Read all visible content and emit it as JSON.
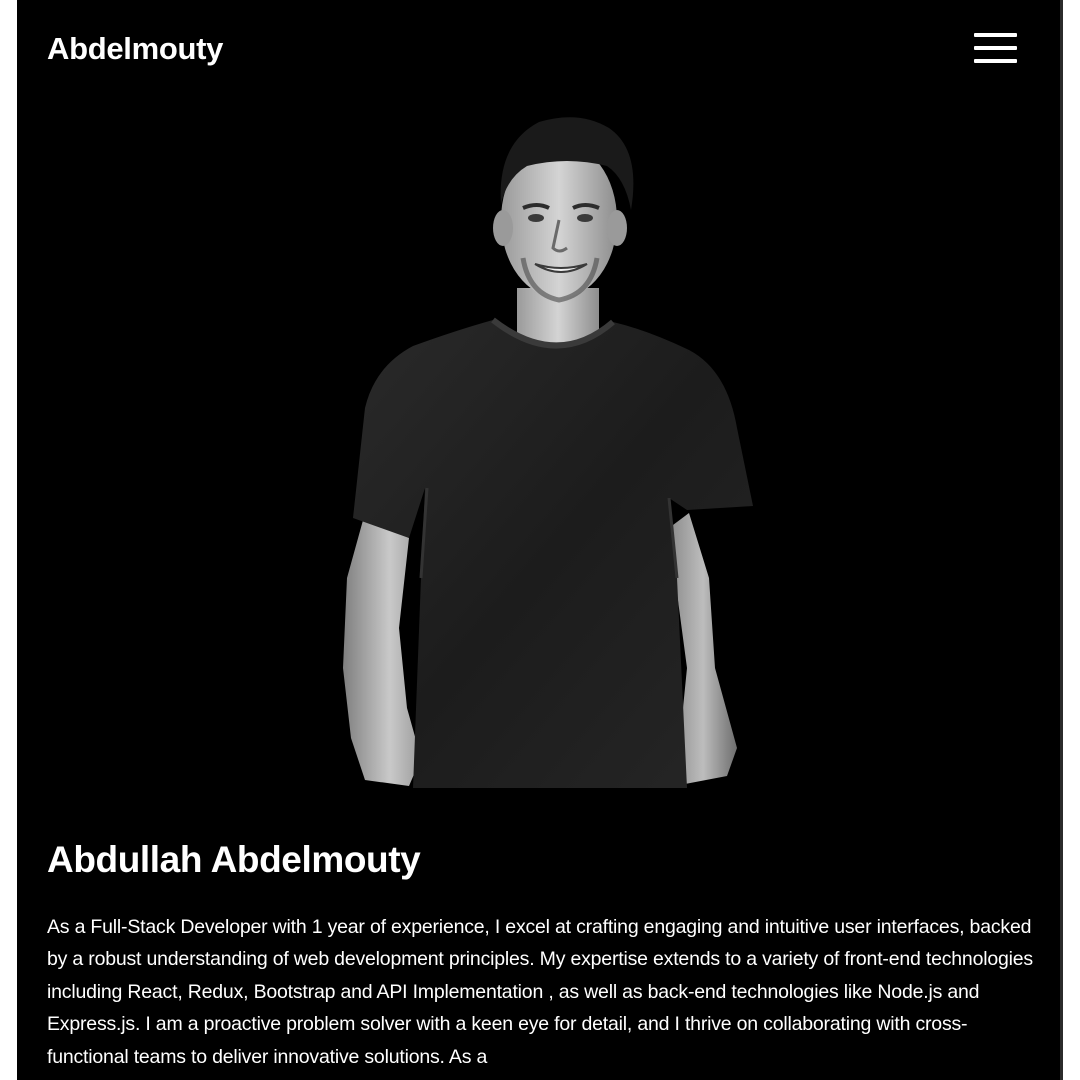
{
  "navbar": {
    "brand": "Abdelmouty",
    "menu_icon": "hamburger-menu-icon"
  },
  "hero": {
    "photo_description_icon": "portrait-photo",
    "name": "Abdullah Abdelmouty",
    "bio": "As a Full-Stack Developer with 1 year of experience, I excel at crafting engaging and intuitive user interfaces, backed by a robust understanding of web development principles. My expertise extends to a variety of front-end technologies including React, Redux, Bootstrap and API Implementation , as well as back-end technologies like Node.js and Express.js. I am a proactive problem solver with a keen eye for detail, and I thrive on collaborating with cross-functional teams to deliver innovative solutions. As a"
  },
  "colors": {
    "background": "#000000",
    "text": "#ffffff",
    "page_margin": "#ffffff"
  }
}
